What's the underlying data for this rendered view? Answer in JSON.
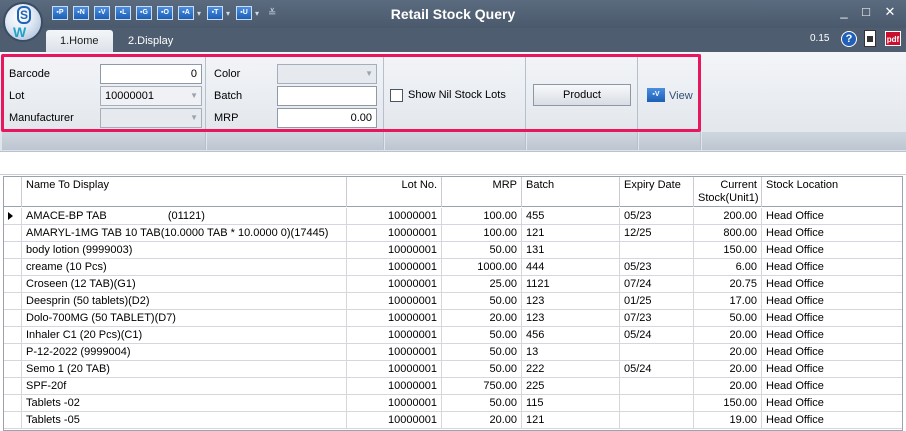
{
  "window": {
    "title": "Retail Stock Query",
    "quick_access": [
      {
        "label": "P"
      },
      {
        "label": "N"
      },
      {
        "label": "V"
      },
      {
        "label": "L"
      },
      {
        "label": "G"
      },
      {
        "label": "O"
      },
      {
        "label": "A"
      },
      {
        "label": "T"
      },
      {
        "label": "U"
      }
    ],
    "minimize": "_",
    "maximize": "□",
    "close": "✕"
  },
  "tabs": [
    {
      "label": "1.Home"
    },
    {
      "label": "2.Display"
    }
  ],
  "status": {
    "version": "0.15",
    "help": "?",
    "pdf": "pdf"
  },
  "filters": {
    "barcode_label": "Barcode",
    "barcode_value": "0",
    "lot_label": "Lot",
    "lot_value": "10000001",
    "manufacturer_label": "Manufacturer",
    "manufacturer_value": "",
    "color_label": "Color",
    "color_value": "",
    "batch_label": "Batch",
    "batch_value": "",
    "mrp_label": "MRP",
    "mrp_value": "0.00",
    "nil_stock_label": "Show Nil Stock Lots",
    "product_label": "Product",
    "view_label": "View"
  },
  "grid": {
    "columns": [
      "Name To Display",
      "Lot No.",
      "MRP",
      "Batch",
      "Expiry Date",
      "Current Stock(Unit1)",
      "Stock Location"
    ],
    "rows": [
      [
        "AMACE-BP TAB                    (01121)",
        "10000001",
        "100.00",
        "455",
        "05/23",
        "200.00",
        "Head Office"
      ],
      [
        "AMARYL-1MG TAB 10 TAB(10.0000 TAB * 10.0000 0)(17445)",
        "10000001",
        "100.00",
        "121",
        "12/25",
        "800.00",
        "Head Office"
      ],
      [
        "body lotion (9999003)",
        "10000001",
        "50.00",
        "131",
        "",
        "150.00",
        "Head Office"
      ],
      [
        "creame (10 Pcs)",
        "10000001",
        "1000.00",
        "444",
        "05/23",
        "6.00",
        "Head Office"
      ],
      [
        "Croseen (12 TAB)(G1)",
        "10000001",
        "25.00",
        "1121",
        "07/24",
        "20.75",
        "Head Office"
      ],
      [
        "Deesprin (50 tablets)(D2)",
        "10000001",
        "50.00",
        "123",
        "01/25",
        "17.00",
        "Head Office"
      ],
      [
        "Dolo-700MG (50 TABLET)(D7)",
        "10000001",
        "20.00",
        "123",
        "07/23",
        "50.00",
        "Head Office"
      ],
      [
        "Inhaler C1 (20 Pcs)(C1)",
        "10000001",
        "50.00",
        "456",
        "05/24",
        "20.00",
        "Head Office"
      ],
      [
        "P-12-2022 (9999004)",
        "10000001",
        "50.00",
        "13",
        "",
        "20.00",
        "Head Office"
      ],
      [
        "Semo 1 (20 TAB)",
        "10000001",
        "50.00",
        "222",
        "05/24",
        "20.00",
        "Head Office"
      ],
      [
        "SPF-20f",
        "10000001",
        "750.00",
        "225",
        "",
        "20.00",
        "Head Office"
      ],
      [
        "Tablets -02",
        "10000001",
        "50.00",
        "115",
        "",
        "150.00",
        "Head Office"
      ],
      [
        "Tablets -05",
        "10000001",
        "20.00",
        "121",
        "",
        "19.00",
        "Head Office"
      ]
    ]
  }
}
